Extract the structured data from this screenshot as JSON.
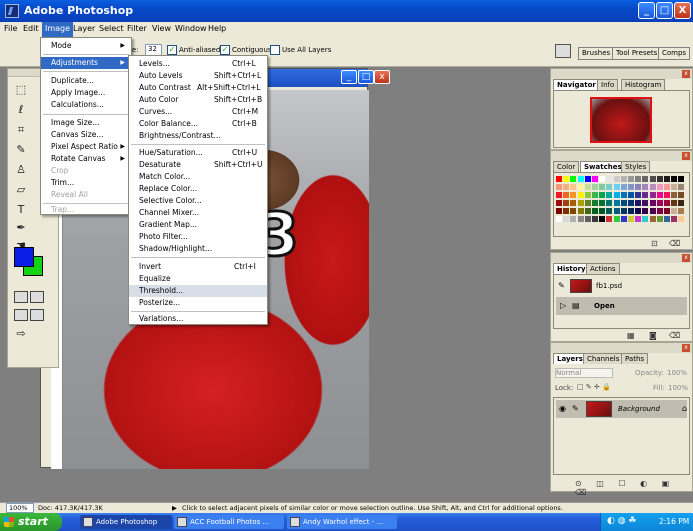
{
  "window": {
    "title": "Adobe Photoshop",
    "min": "_",
    "max": "□",
    "close": "X"
  },
  "menubar": [
    "File",
    "Edit",
    "Image",
    "Layer",
    "Select",
    "Filter",
    "View",
    "Window",
    "Help"
  ],
  "options": {
    "tolerance_label_fragment": "ce:",
    "tolerance": "32",
    "anti_aliased": "Anti-aliased",
    "contiguous": "Contiguous",
    "use_all_layers": "Use All Layers",
    "tabs": [
      "Brushes",
      "Tool Presets",
      "Comps"
    ]
  },
  "image_menu": [
    {
      "label": "Mode",
      "arrow": true
    },
    {
      "label": "Adjustments",
      "arrow": true,
      "highlighted": true
    },
    {
      "label": "Duplicate..."
    },
    {
      "label": "Apply Image..."
    },
    {
      "label": "Calculations..."
    },
    {
      "label": "Image Size..."
    },
    {
      "label": "Canvas Size..."
    },
    {
      "label": "Pixel Aspect Ratio",
      "arrow": true
    },
    {
      "label": "Rotate Canvas",
      "arrow": true
    },
    {
      "label": "Crop",
      "disabled": true
    },
    {
      "label": "Trim..."
    },
    {
      "label": "Reveal All",
      "disabled": true
    },
    {
      "label": "Trap...",
      "disabled": true
    }
  ],
  "adjustments_menu": [
    {
      "label": "Levels...",
      "shortcut": "Ctrl+L"
    },
    {
      "label": "Auto Levels",
      "shortcut": "Shift+Ctrl+L"
    },
    {
      "label": "Auto Contrast",
      "shortcut": "Alt+Shift+Ctrl+L"
    },
    {
      "label": "Auto Color",
      "shortcut": "Shift+Ctrl+B"
    },
    {
      "label": "Curves...",
      "shortcut": "Ctrl+M"
    },
    {
      "label": "Color Balance...",
      "shortcut": "Ctrl+B"
    },
    {
      "label": "Brightness/Contrast..."
    },
    {
      "label": "Hue/Saturation...",
      "shortcut": "Ctrl+U"
    },
    {
      "label": "Desaturate",
      "shortcut": "Shift+Ctrl+U"
    },
    {
      "label": "Match Color..."
    },
    {
      "label": "Replace Color..."
    },
    {
      "label": "Selective Color..."
    },
    {
      "label": "Channel Mixer..."
    },
    {
      "label": "Gradient Map..."
    },
    {
      "label": "Photo Filter..."
    },
    {
      "label": "Shadow/Highlight..."
    },
    {
      "label": "Invert",
      "shortcut": "Ctrl+I"
    },
    {
      "label": "Equalize"
    },
    {
      "label": "Threshold...",
      "highlighted": true
    },
    {
      "label": "Posterize..."
    },
    {
      "label": "Variations..."
    }
  ],
  "document": {
    "ruler_mark": "4"
  },
  "navigator": {
    "tabs": [
      "Navigator",
      "Info",
      "Histogram"
    ]
  },
  "swatches": {
    "tabs": [
      "Color",
      "Swatches",
      "Styles"
    ]
  },
  "history": {
    "tabs": [
      "History",
      "Actions"
    ],
    "file": "fb1.psd",
    "state": "Open"
  },
  "layers": {
    "tabs": [
      "Layers",
      "Channels",
      "Paths"
    ],
    "blend": "Normal",
    "opacity_label": "Opacity:",
    "opacity": "100%",
    "lock_label": "Lock:",
    "fill_label": "Fill:",
    "fill": "100%",
    "layer_name": "Background"
  },
  "status": {
    "zoom": "100%",
    "doc": "Doc: 417.3K/417.3K",
    "hint": "Click to select adjacent pixels of similar color or move selection outline.  Use Shift, Alt, and Ctrl for additional options."
  },
  "taskbar": {
    "start": "start",
    "tasks": [
      "Adobe Photoshop",
      "ACC Football Photos ...",
      "Andy Warhol effect - ..."
    ],
    "clock": "2:16 PM"
  },
  "colors": {
    "foreground": "#0a1ee8",
    "background": "#14d214",
    "menu_highlight": "#316ac5",
    "xp_blue": "#245edb"
  }
}
